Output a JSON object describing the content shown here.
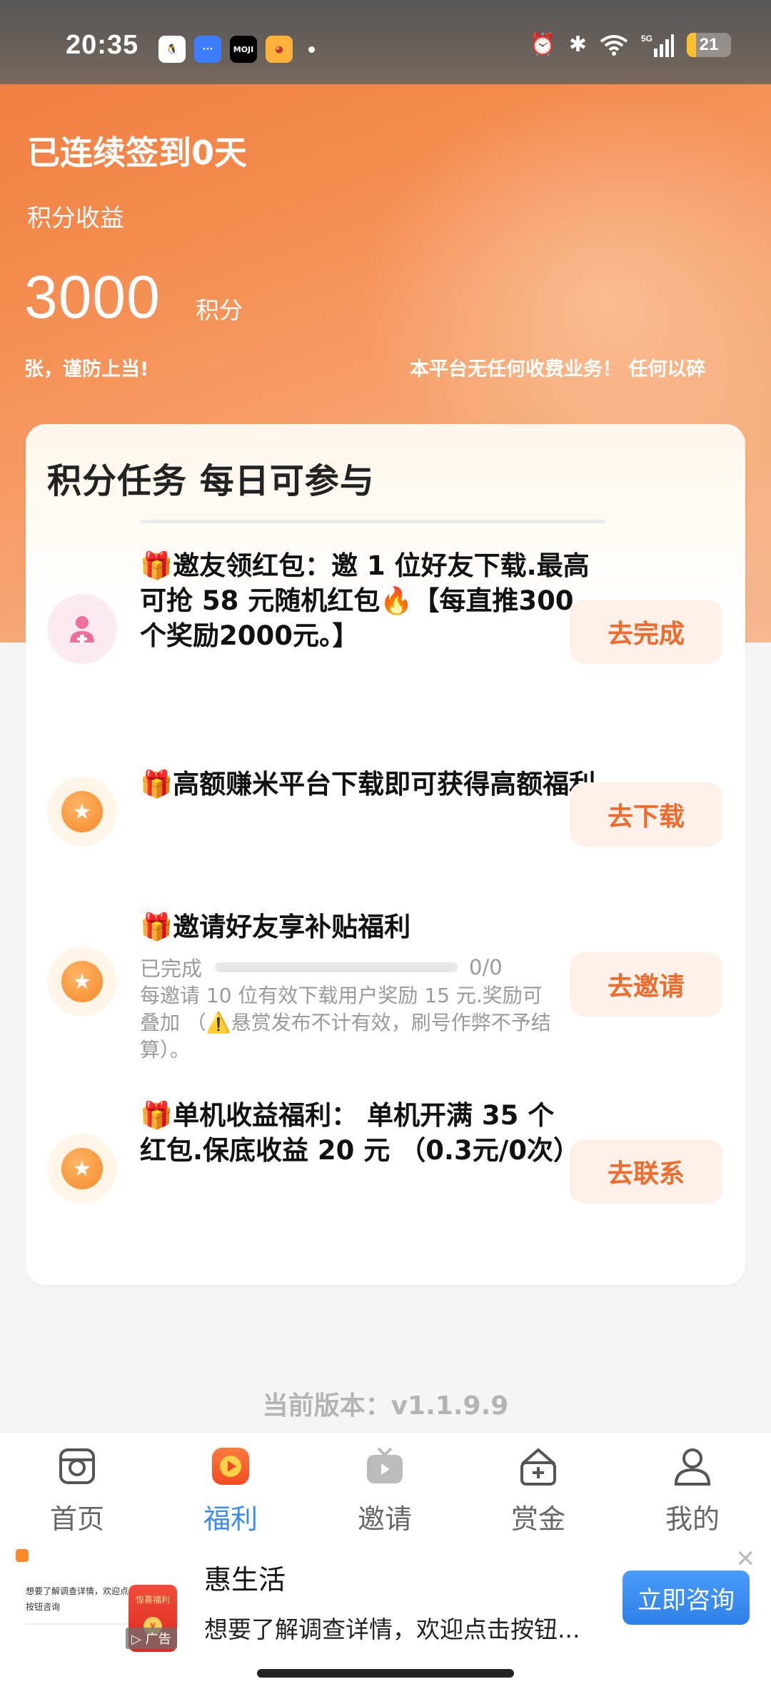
{
  "status_bar": {
    "time": "20:35",
    "apps": [
      "QQ",
      "消息",
      "MOJI",
      "宠物"
    ],
    "network": "5G",
    "battery_level": "21",
    "battery_fraction": 0.21
  },
  "header": {
    "streak_text": "已连续签到0天",
    "points_label": "积分收益",
    "points_value": "3000",
    "points_unit": "积分",
    "marquee_left": "张，谨防上当!",
    "marquee_right": "本平台无任何收费业务！ 任何以碎"
  },
  "tasks_card": {
    "title": "积分任务  每日可参与",
    "tasks": [
      {
        "icon": "user-icon",
        "text": "🎁邀友领红包：邀 1 位好友下载.最高可抢 58 元随机红包🔥【每直推300个奖励2000元。】",
        "button": "去完成"
      },
      {
        "icon": "star-icon",
        "text": "🎁高额赚米平台下载即可获得高额福利",
        "button": "去下载"
      },
      {
        "icon": "star-icon",
        "text": "🎁邀请好友享补贴福利",
        "progress_label": "已完成",
        "progress_value": "0/0",
        "description": "每邀请 10 位有效下载用户奖励 15 元.奖励可叠加 （⚠️悬赏发布不计有效，刷号作弊不予结算）。",
        "button": "去邀请"
      },
      {
        "icon": "star-icon",
        "text": "🎁单机收益福利： 单机开满 35 个红包.保底收益 20 元 （0.3元/0次）",
        "button": "去联系"
      }
    ]
  },
  "version_text": "当前版本：v1.1.9.9",
  "tab_bar": {
    "tabs": [
      {
        "label": "首页",
        "icon": "home-icon"
      },
      {
        "label": "福利",
        "icon": "play-icon",
        "active": true
      },
      {
        "label": "邀请",
        "icon": "tv-icon"
      },
      {
        "label": "赏金",
        "icon": "bounty-icon"
      },
      {
        "label": "我的",
        "icon": "profile-icon"
      }
    ]
  },
  "ad": {
    "thumb_text": "想要了解调查详情，欢迎点击按钮咨询",
    "envelope_text": "惊喜福利",
    "tag": "广告",
    "title": "惠生活",
    "description": "想要了解调查详情，欢迎点击按钮...",
    "cta": "立即咨询"
  },
  "colors": {
    "accent": "#f06a2b",
    "tab_active": "#3d8bf2",
    "header_gradient_start": "#f07a3e"
  }
}
